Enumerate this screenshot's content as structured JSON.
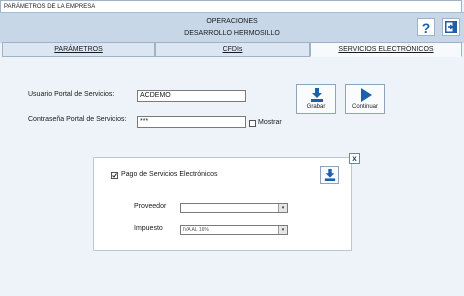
{
  "window": {
    "title": "PARÁMETROS DE LA EMPRESA"
  },
  "header": {
    "line1": "OPERACIONES",
    "line2": "DESARROLLO HERMOSILLO",
    "help_label": "?"
  },
  "tabs": [
    {
      "label": "PARÁMETROS",
      "active": false
    },
    {
      "label": "CFDIs",
      "active": false
    },
    {
      "label": "SERVICIOS ELECTRÓNICOS",
      "active": true
    }
  ],
  "form": {
    "user_label": "Usuario Portal de Servicios:",
    "user_value": "ACDEMO",
    "password_label": "Contraseña Portal de Servicios:",
    "password_value": "***",
    "show_label": "Mostrar",
    "show_checked": false
  },
  "buttons": {
    "save_label": "Grabar",
    "continue_label": "Continuar"
  },
  "panel": {
    "close_label": "x",
    "checkbox_label": "Pago de Servicios Electrónicos",
    "checkbox_checked": true,
    "provider_label": "Proveedor",
    "provider_value": "",
    "tax_label": "Impuesto",
    "tax_value": "IVA AL 16%"
  },
  "colors": {
    "accent": "#1d5fa8",
    "header_bg": "#c8d7e8",
    "page_bg": "#eef3f9"
  }
}
